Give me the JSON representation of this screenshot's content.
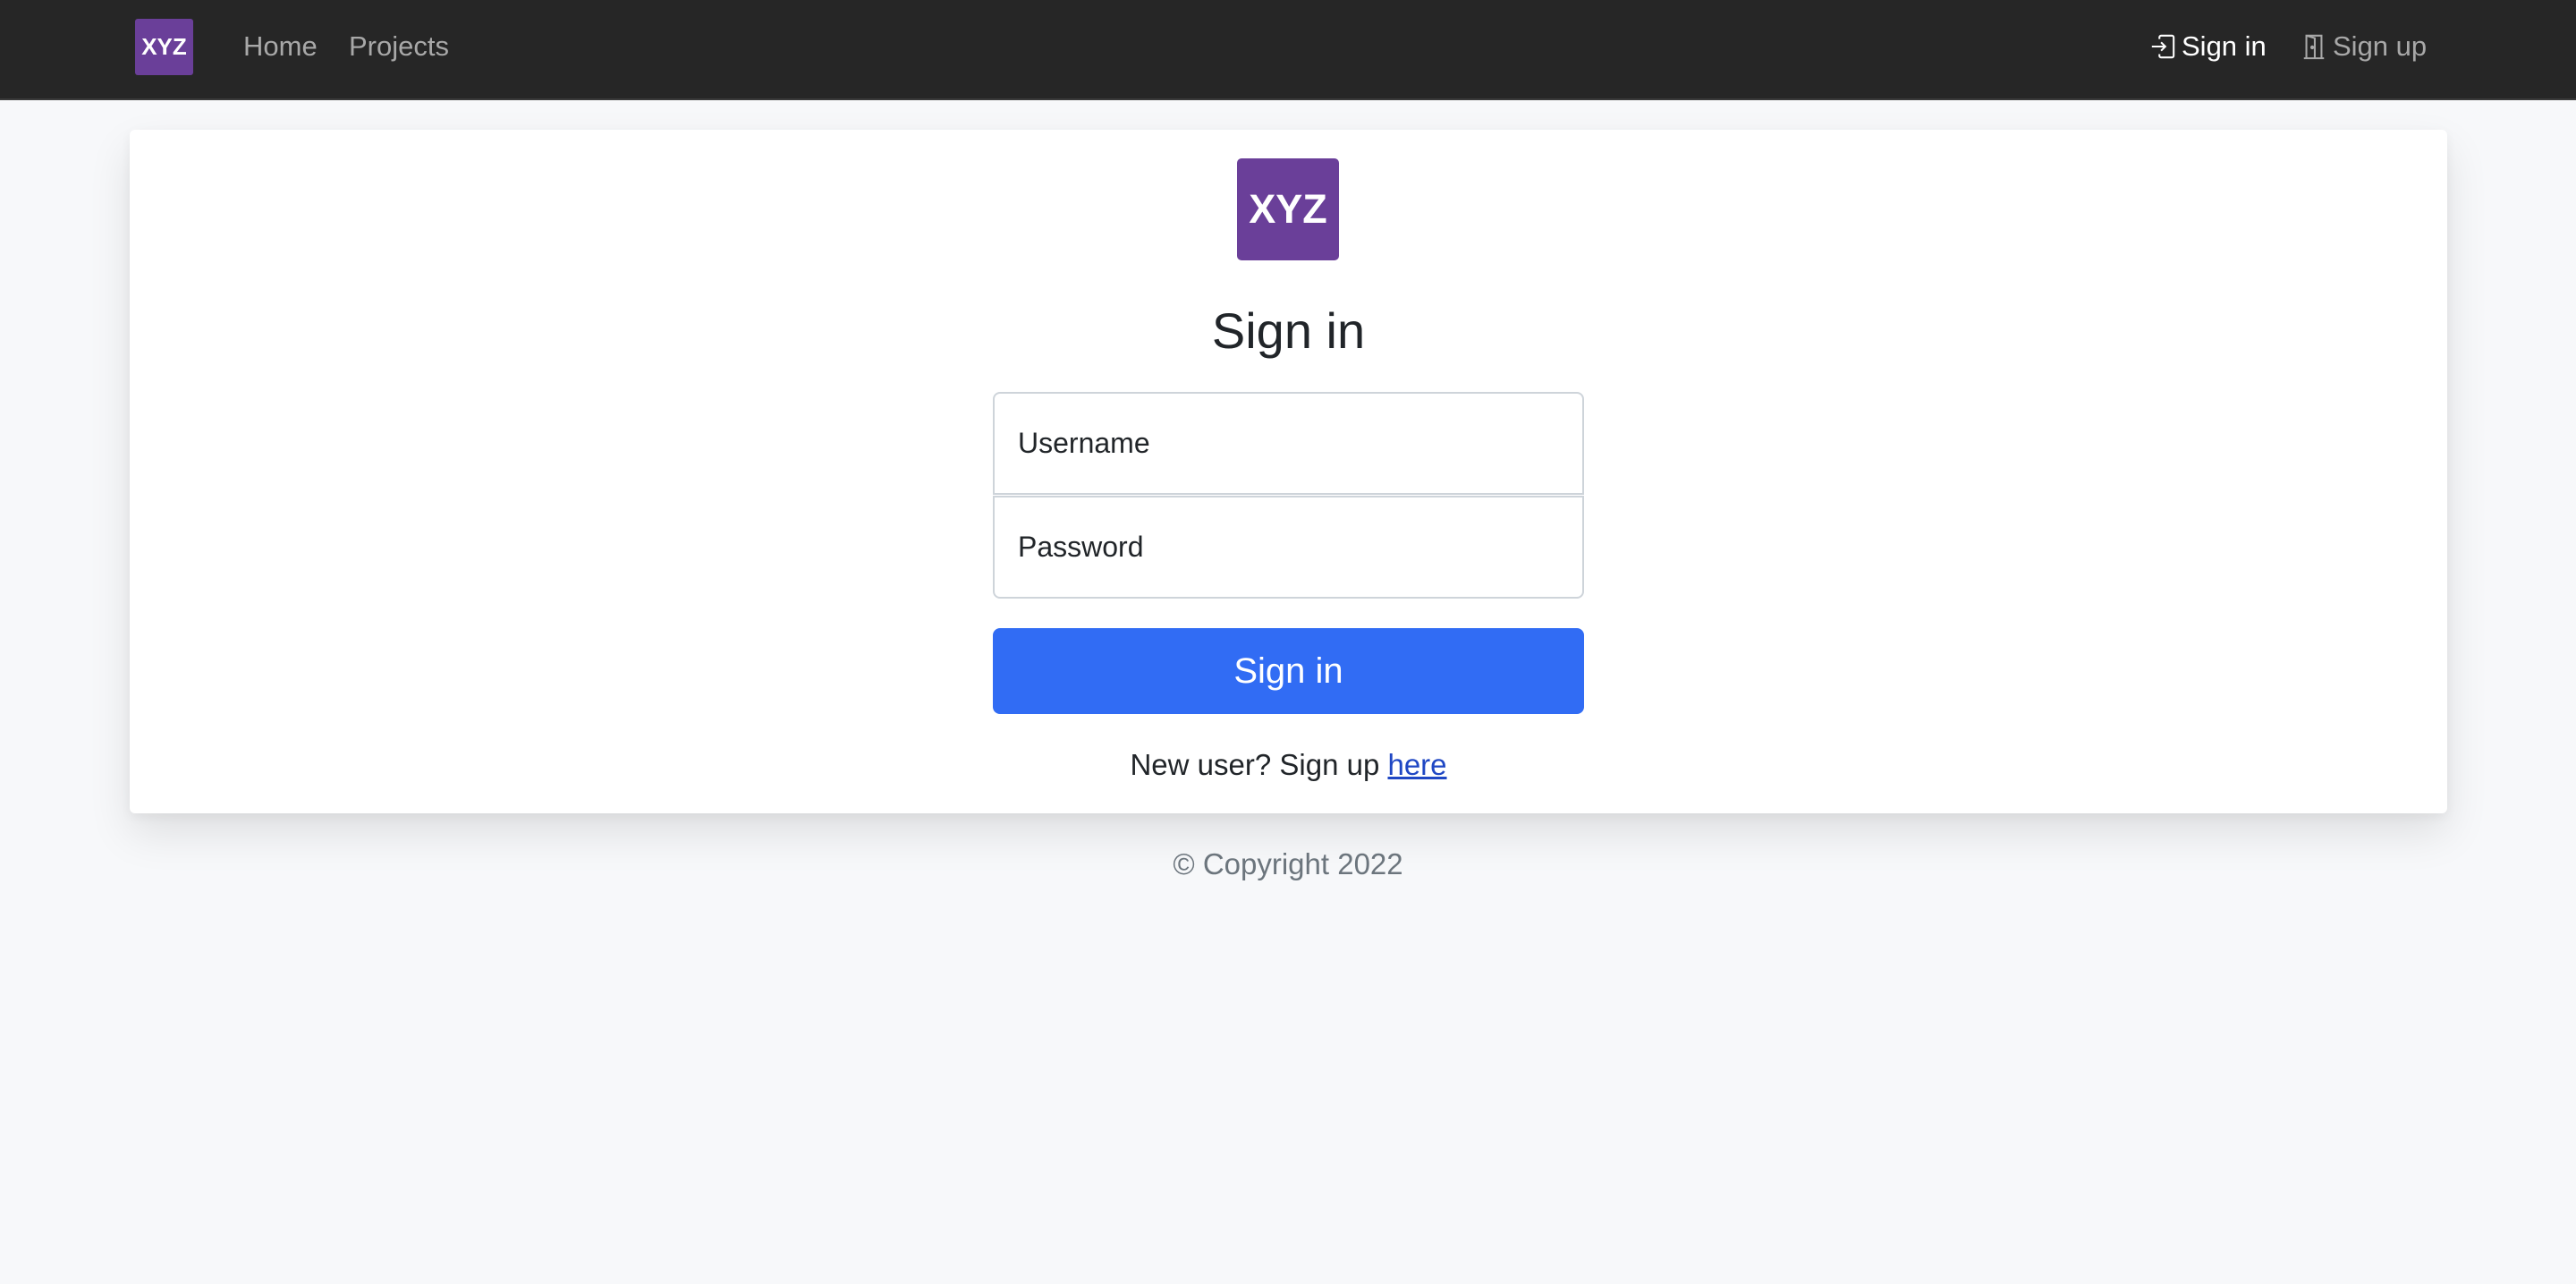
{
  "navbar": {
    "logo_text": "XYZ",
    "links": [
      {
        "label": "Home"
      },
      {
        "label": "Projects"
      }
    ],
    "sign_in": {
      "label": "Sign in",
      "icon": "box-arrow-in-right-icon"
    },
    "sign_up": {
      "label": "Sign up",
      "icon": "door-icon"
    }
  },
  "card": {
    "logo_text": "XYZ",
    "title": "Sign in",
    "username_placeholder": "Username",
    "password_placeholder": "Password",
    "submit_label": "Sign in",
    "signup_prompt": "New user? Sign up ",
    "signup_link": "here"
  },
  "footer": {
    "text": "© Copyright 2022"
  },
  "colors": {
    "navbar_bg": "#262626",
    "brand": "#6a3f99",
    "primary": "#316cf4",
    "link": "#1f47c4",
    "page_bg": "#f7f8fa"
  }
}
